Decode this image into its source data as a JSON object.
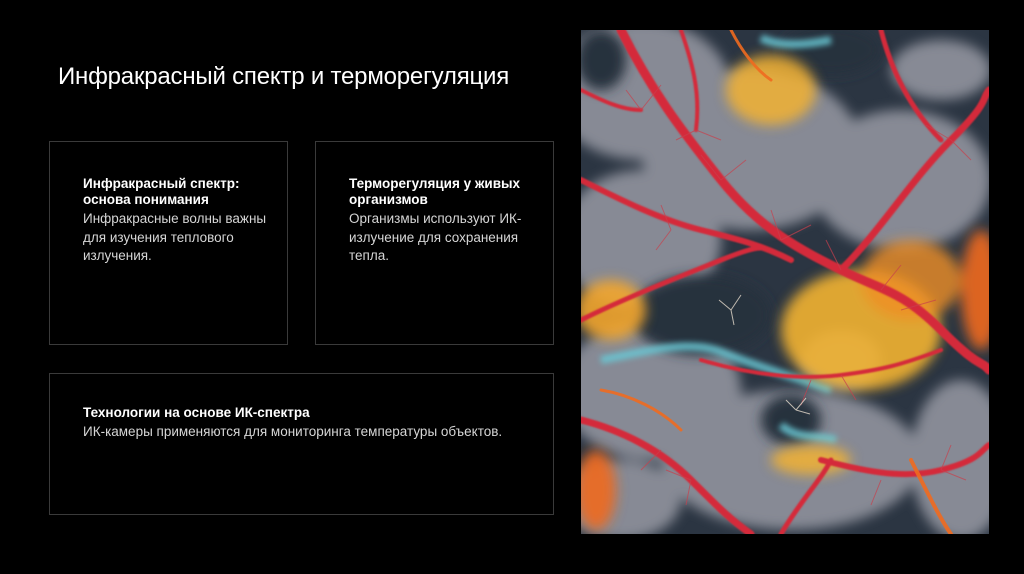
{
  "slide": {
    "title": "Инфракрасный спектр и терморегуляция"
  },
  "cards": [
    {
      "heading": "Инфракрасный спектр: основа понимания",
      "body": "Инфракрасные волны важны для изучения теплового излучения."
    },
    {
      "heading": "Терморегуляция у живых организмов",
      "body": "Организмы используют ИК-излучение для сохранения тепла."
    },
    {
      "heading": "Технологии на основе ИК-спектра",
      "body": "ИК-камеры применяются для мониторинга температуры объектов."
    }
  ],
  "image": {
    "icon": "thermal-vein-image",
    "colors": {
      "background": "#2b3542",
      "gray": "#8c8f9a",
      "red": "#d42c3a",
      "orange": "#ef6a1f",
      "yellow": "#f2b232",
      "cyan": "#69c7d4"
    }
  }
}
